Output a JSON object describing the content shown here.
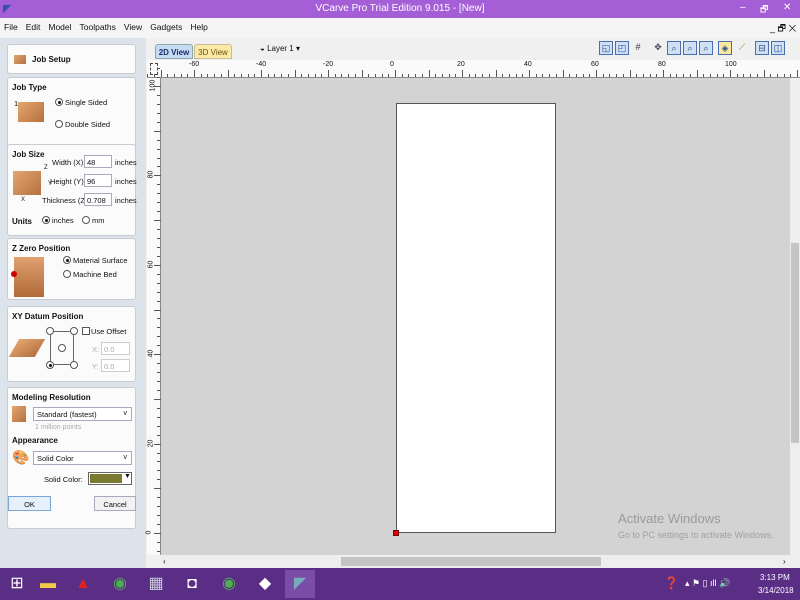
{
  "window": {
    "title": "VCarve Pro Trial Edition 9.015 - [New]",
    "min": "–",
    "max": "🗗",
    "close": "✕",
    "sub_controls": "_ 🗗 ✕"
  },
  "menu": [
    "File",
    "Edit",
    "Model",
    "Toolpaths",
    "View",
    "Gadgets",
    "Help"
  ],
  "job_setup": {
    "title": "Job Setup",
    "job_type": {
      "heading": "Job Type",
      "side_marker": "1",
      "single": "Single Sided",
      "double": "Double Sided",
      "selected": "single"
    },
    "job_size": {
      "heading": "Job Size",
      "width_label": "Width (X):",
      "width": "48",
      "height_label": "Height (Y):",
      "height": "96",
      "thickness_label": "Thickness (Z):",
      "thickness": "0.708",
      "unit": "inches",
      "units_label": "Units",
      "inches": "inches",
      "mm": "mm",
      "axis_x": "X",
      "axis_y": "Y",
      "axis_z": "Z"
    },
    "z_zero": {
      "heading": "Z Zero Position",
      "material_surface": "Material Surface",
      "machine_bed": "Machine Bed",
      "selected": "material_surface"
    },
    "xy_datum": {
      "heading": "XY Datum Position",
      "use_offset": "Use Offset",
      "x_label": "X:",
      "x": "0.0",
      "y_label": "Y:",
      "y": "0.0"
    },
    "resolution": {
      "heading": "Modeling Resolution",
      "value": "Standard (fastest)",
      "note": "1 million points"
    },
    "appearance": {
      "heading": "Appearance",
      "value": "Solid Color",
      "solid_color_label": "Solid Color:",
      "color": "#7a7a30"
    },
    "ok": "OK",
    "cancel": "Cancel"
  },
  "view": {
    "tab_2d": "2D View",
    "tab_3d": "3D View",
    "layer": "Layer 1 ▾",
    "ruler_x": [
      "-60",
      "-40",
      "-20",
      "0",
      "20",
      "40",
      "60",
      "80",
      "100"
    ],
    "ruler_y": [
      "100",
      "80",
      "60",
      "40",
      "20",
      "0"
    ]
  },
  "watermark": {
    "line1": "Activate Windows",
    "line2": "Go to PC settings to activate Windows."
  },
  "taskbar": {
    "time": "3:13 PM",
    "date": "3/14/2018"
  },
  "colors": {
    "titlebar": "#a45fd6",
    "taskbar": "#5b2e86",
    "material_origin": "#dd0000"
  }
}
